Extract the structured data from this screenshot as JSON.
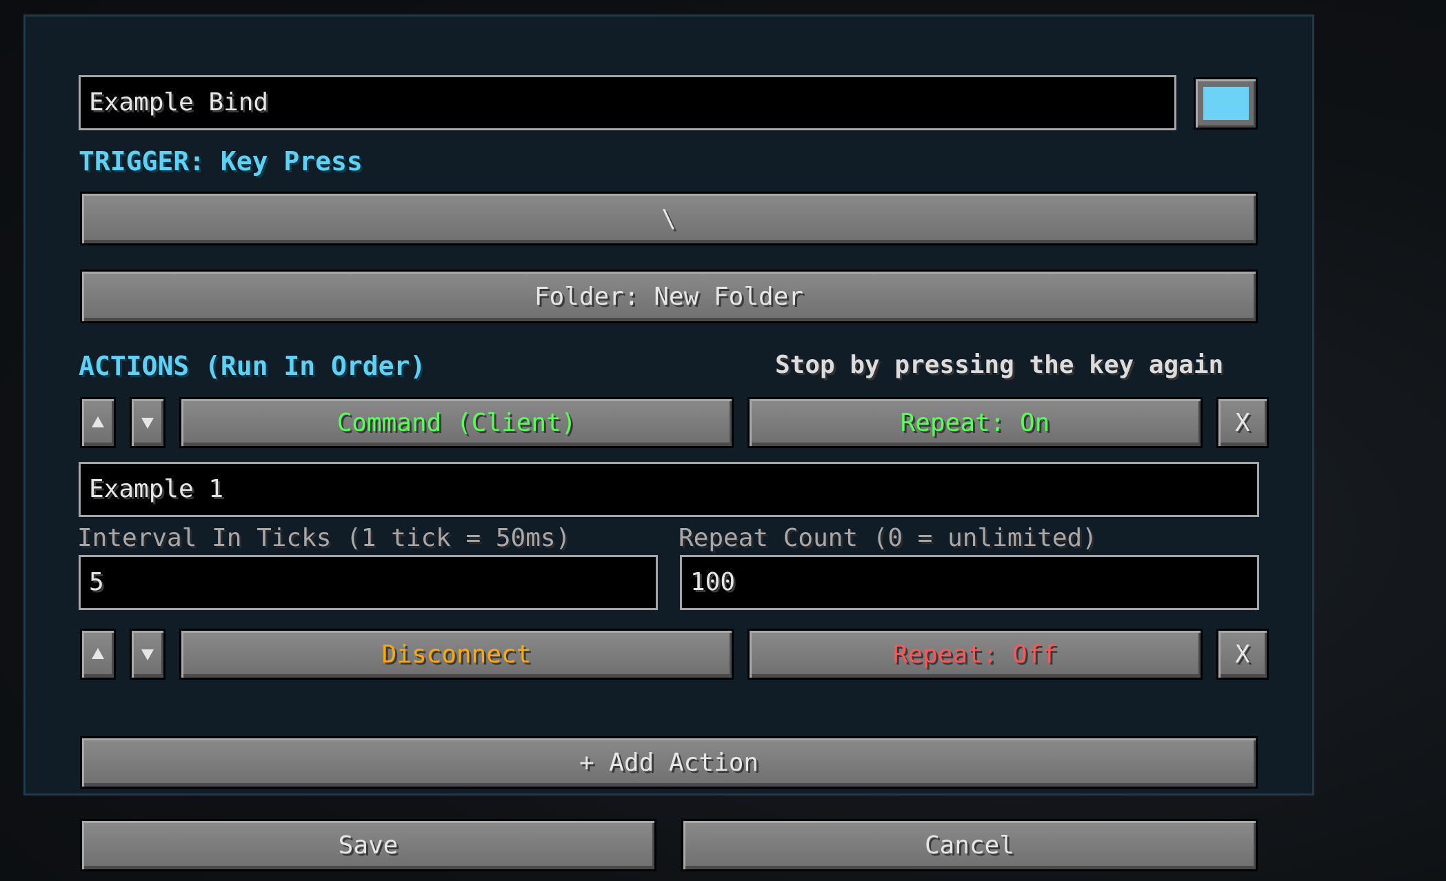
{
  "bind": {
    "name_value": "Example Bind",
    "color": "#6cd3f7"
  },
  "trigger": {
    "heading": "TRIGGER: Key Press",
    "key_label": "\\"
  },
  "folder": {
    "label": "Folder: New Folder"
  },
  "actions": {
    "heading": "ACTIONS (Run In Order)",
    "hint": "Stop by pressing the key again",
    "items": [
      {
        "type_label": "Command (Client)",
        "type_color": "#55ff55",
        "repeat_label": "Repeat: On",
        "repeat_color": "#55ff55",
        "remove_label": "X",
        "command_value": "Example 1",
        "interval_label": "Interval In Ticks (1 tick = 50ms)",
        "interval_value": "5",
        "count_label": "Repeat Count (0 = unlimited)",
        "count_value": "100"
      },
      {
        "type_label": "Disconnect",
        "type_color": "#ffaa00",
        "repeat_label": "Repeat: Off",
        "repeat_color": "#ff5555",
        "remove_label": "X"
      }
    ],
    "add_label": "+ Add Action"
  },
  "footer": {
    "save_label": "Save",
    "cancel_label": "Cancel"
  }
}
